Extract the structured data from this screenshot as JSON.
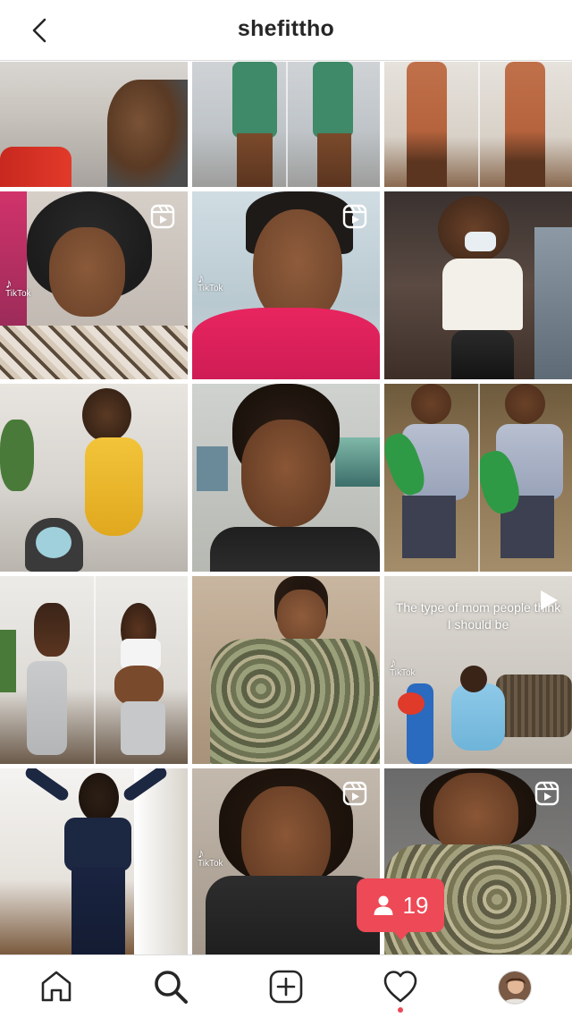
{
  "header": {
    "title": "shefittho"
  },
  "posts": [
    {
      "type": "image"
    },
    {
      "type": "image"
    },
    {
      "type": "image"
    },
    {
      "type": "reel",
      "tiktok": "TikTok"
    },
    {
      "type": "reel",
      "tiktok": "TikTok"
    },
    {
      "type": "image"
    },
    {
      "type": "image"
    },
    {
      "type": "image"
    },
    {
      "type": "image"
    },
    {
      "type": "image"
    },
    {
      "type": "image"
    },
    {
      "type": "video",
      "tiktok": "TikTok",
      "overlay_text": "The type of mom people think I should be"
    },
    {
      "type": "image"
    },
    {
      "type": "reel",
      "tiktok": "TikTok"
    },
    {
      "type": "reel"
    }
  ],
  "followers_badge": {
    "count": "19"
  },
  "colors": {
    "accent": "#ed4956",
    "text": "#262626",
    "divider": "#dbdbdb"
  },
  "nav": {
    "items": [
      {
        "name": "home",
        "icon": "home-icon"
      },
      {
        "name": "search",
        "icon": "search-icon"
      },
      {
        "name": "create",
        "icon": "plus-square-icon"
      },
      {
        "name": "activity",
        "icon": "heart-icon"
      },
      {
        "name": "profile",
        "icon": "avatar"
      }
    ]
  }
}
